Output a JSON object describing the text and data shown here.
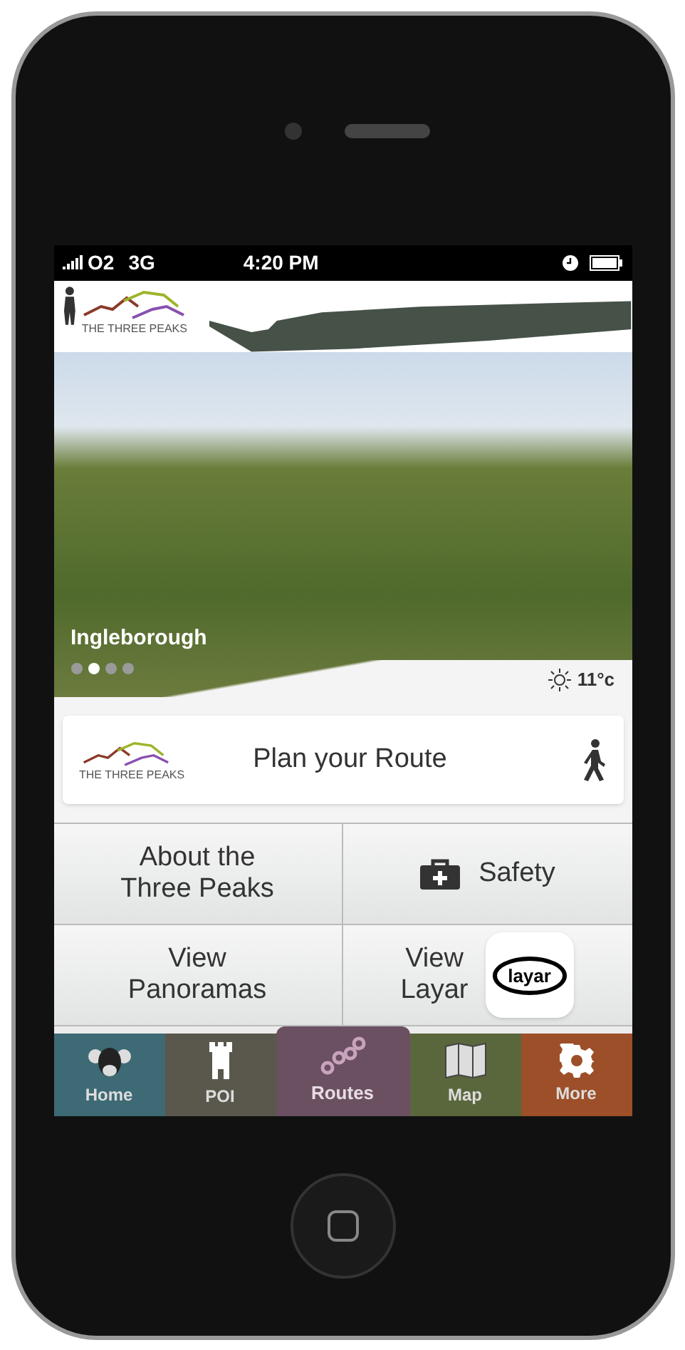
{
  "status_bar": {
    "signal_label": "O2",
    "network": "3G",
    "time": "4:20 PM"
  },
  "header": {
    "logo_text": "THE THREE PEAKS"
  },
  "hero": {
    "caption": "Ingleborough",
    "temperature": "11°c",
    "dots": [
      {
        "selected": false
      },
      {
        "selected": true
      },
      {
        "selected": false
      },
      {
        "selected": false
      }
    ]
  },
  "plan_card": {
    "logo_text": "THE THREE PEAKS",
    "label": "Plan your Route"
  },
  "menu": [
    {
      "kind": "text",
      "label_lines": [
        "About the",
        "Three Peaks"
      ]
    },
    {
      "kind": "safety",
      "label_lines": [
        "Safety"
      ]
    },
    {
      "kind": "text",
      "label_lines": [
        "View",
        "Panoramas"
      ]
    },
    {
      "kind": "layar",
      "label_lines": [
        "View",
        "Layar"
      ],
      "badge": "layar"
    }
  ],
  "tab_bar": [
    {
      "label": "Home",
      "kind": "home",
      "color": "#3d6a74",
      "selected": false
    },
    {
      "label": "POI",
      "kind": "poi",
      "color": "#5a584c",
      "selected": false
    },
    {
      "label": "Routes",
      "kind": "routes",
      "color": "#6a5061",
      "selected": true
    },
    {
      "label": "Map",
      "kind": "map",
      "color": "#5a673d",
      "selected": false
    },
    {
      "label": "More",
      "kind": "more",
      "color": "#9c4f28",
      "selected": false
    }
  ]
}
